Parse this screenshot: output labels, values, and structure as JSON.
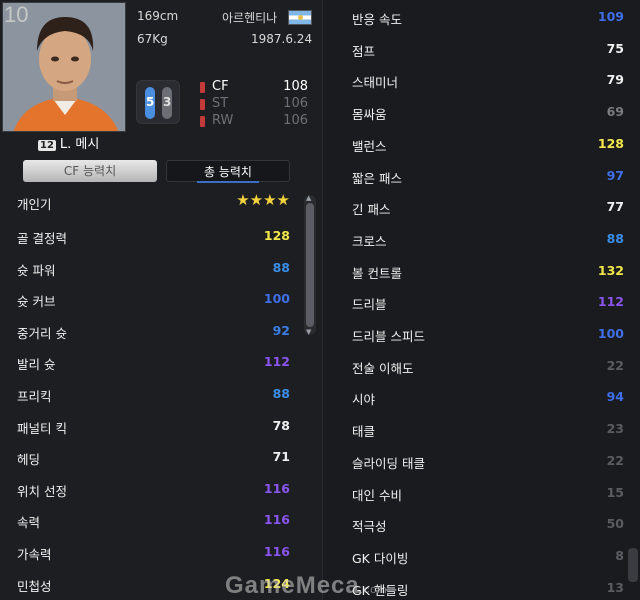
{
  "profile": {
    "jersey_number": "10",
    "height": "169cm",
    "weight": "67Kg",
    "nationality": "아르헨티나",
    "birth_date": "1987.6.24",
    "name_badge": "12",
    "name": "L. 메시",
    "foot": {
      "left": "5",
      "right": "3"
    },
    "positions": [
      {
        "code": "CF",
        "value": "108"
      },
      {
        "code": "ST",
        "value": "106"
      },
      {
        "code": "RW",
        "value": "106"
      }
    ]
  },
  "tabs": [
    {
      "label": "CF 능력치",
      "active": false
    },
    {
      "label": "총 능력치",
      "active": true
    }
  ],
  "left_stats": {
    "popularity_label": "개인기",
    "popularity_stars": "★★★★",
    "items": [
      {
        "label": "골 결정력",
        "value": "128",
        "color": "#f3e84a"
      },
      {
        "label": "슛 파워",
        "value": "88",
        "color": "#3a8ee8"
      },
      {
        "label": "슛 커브",
        "value": "100",
        "color": "#3f6fe8"
      },
      {
        "label": "중거리 슛",
        "value": "92",
        "color": "#3a7fe8"
      },
      {
        "label": "발리 슛",
        "value": "112",
        "color": "#8a55f0"
      },
      {
        "label": "프리킥",
        "value": "88",
        "color": "#3a8ee8"
      },
      {
        "label": "패널티 킥",
        "value": "78",
        "color": "#f0f0f0"
      },
      {
        "label": "헤딩",
        "value": "71",
        "color": "#f0f0f0"
      },
      {
        "label": "위치 선정",
        "value": "116",
        "color": "#8a55f0"
      },
      {
        "label": "속력",
        "value": "116",
        "color": "#8a55f0"
      },
      {
        "label": "가속력",
        "value": "116",
        "color": "#8a55f0"
      },
      {
        "label": "민첩성",
        "value": "124",
        "color": "#f3e84a"
      }
    ]
  },
  "right_stats": [
    {
      "label": "반응 속도",
      "value": "109",
      "color": "#3f6fe8"
    },
    {
      "label": "점프",
      "value": "75",
      "color": "#f0f0f0"
    },
    {
      "label": "스태미너",
      "value": "79",
      "color": "#f0f0f0"
    },
    {
      "label": "몸싸움",
      "value": "69",
      "color": "#7a7c82"
    },
    {
      "label": "밸런스",
      "value": "128",
      "color": "#f3e84a"
    },
    {
      "label": "짧은 패스",
      "value": "97",
      "color": "#3f6fe8"
    },
    {
      "label": "긴 패스",
      "value": "77",
      "color": "#f0f0f0"
    },
    {
      "label": "크로스",
      "value": "88",
      "color": "#3a8ee8"
    },
    {
      "label": "볼 컨트롤",
      "value": "132",
      "color": "#f3e84a"
    },
    {
      "label": "드리블",
      "value": "112",
      "color": "#8a55f0"
    },
    {
      "label": "드리블 스피드",
      "value": "100",
      "color": "#3f6fe8"
    },
    {
      "label": "전술 이해도",
      "value": "22",
      "color": "#5a5c62"
    },
    {
      "label": "시야",
      "value": "94",
      "color": "#3f6fe8"
    },
    {
      "label": "태클",
      "value": "23",
      "color": "#5a5c62"
    },
    {
      "label": "슬라이딩 태클",
      "value": "22",
      "color": "#5a5c62"
    },
    {
      "label": "대인 수비",
      "value": "15",
      "color": "#5a5c62"
    },
    {
      "label": "적극성",
      "value": "50",
      "color": "#5a5c62"
    },
    {
      "label": "GK 다이빙",
      "value": "8",
      "color": "#5a5c62"
    },
    {
      "label": "GK 핸들링",
      "value": "13",
      "color": "#5a5c62"
    }
  ],
  "watermark": {
    "brand": "GameMeca",
    "domain": ".com"
  }
}
